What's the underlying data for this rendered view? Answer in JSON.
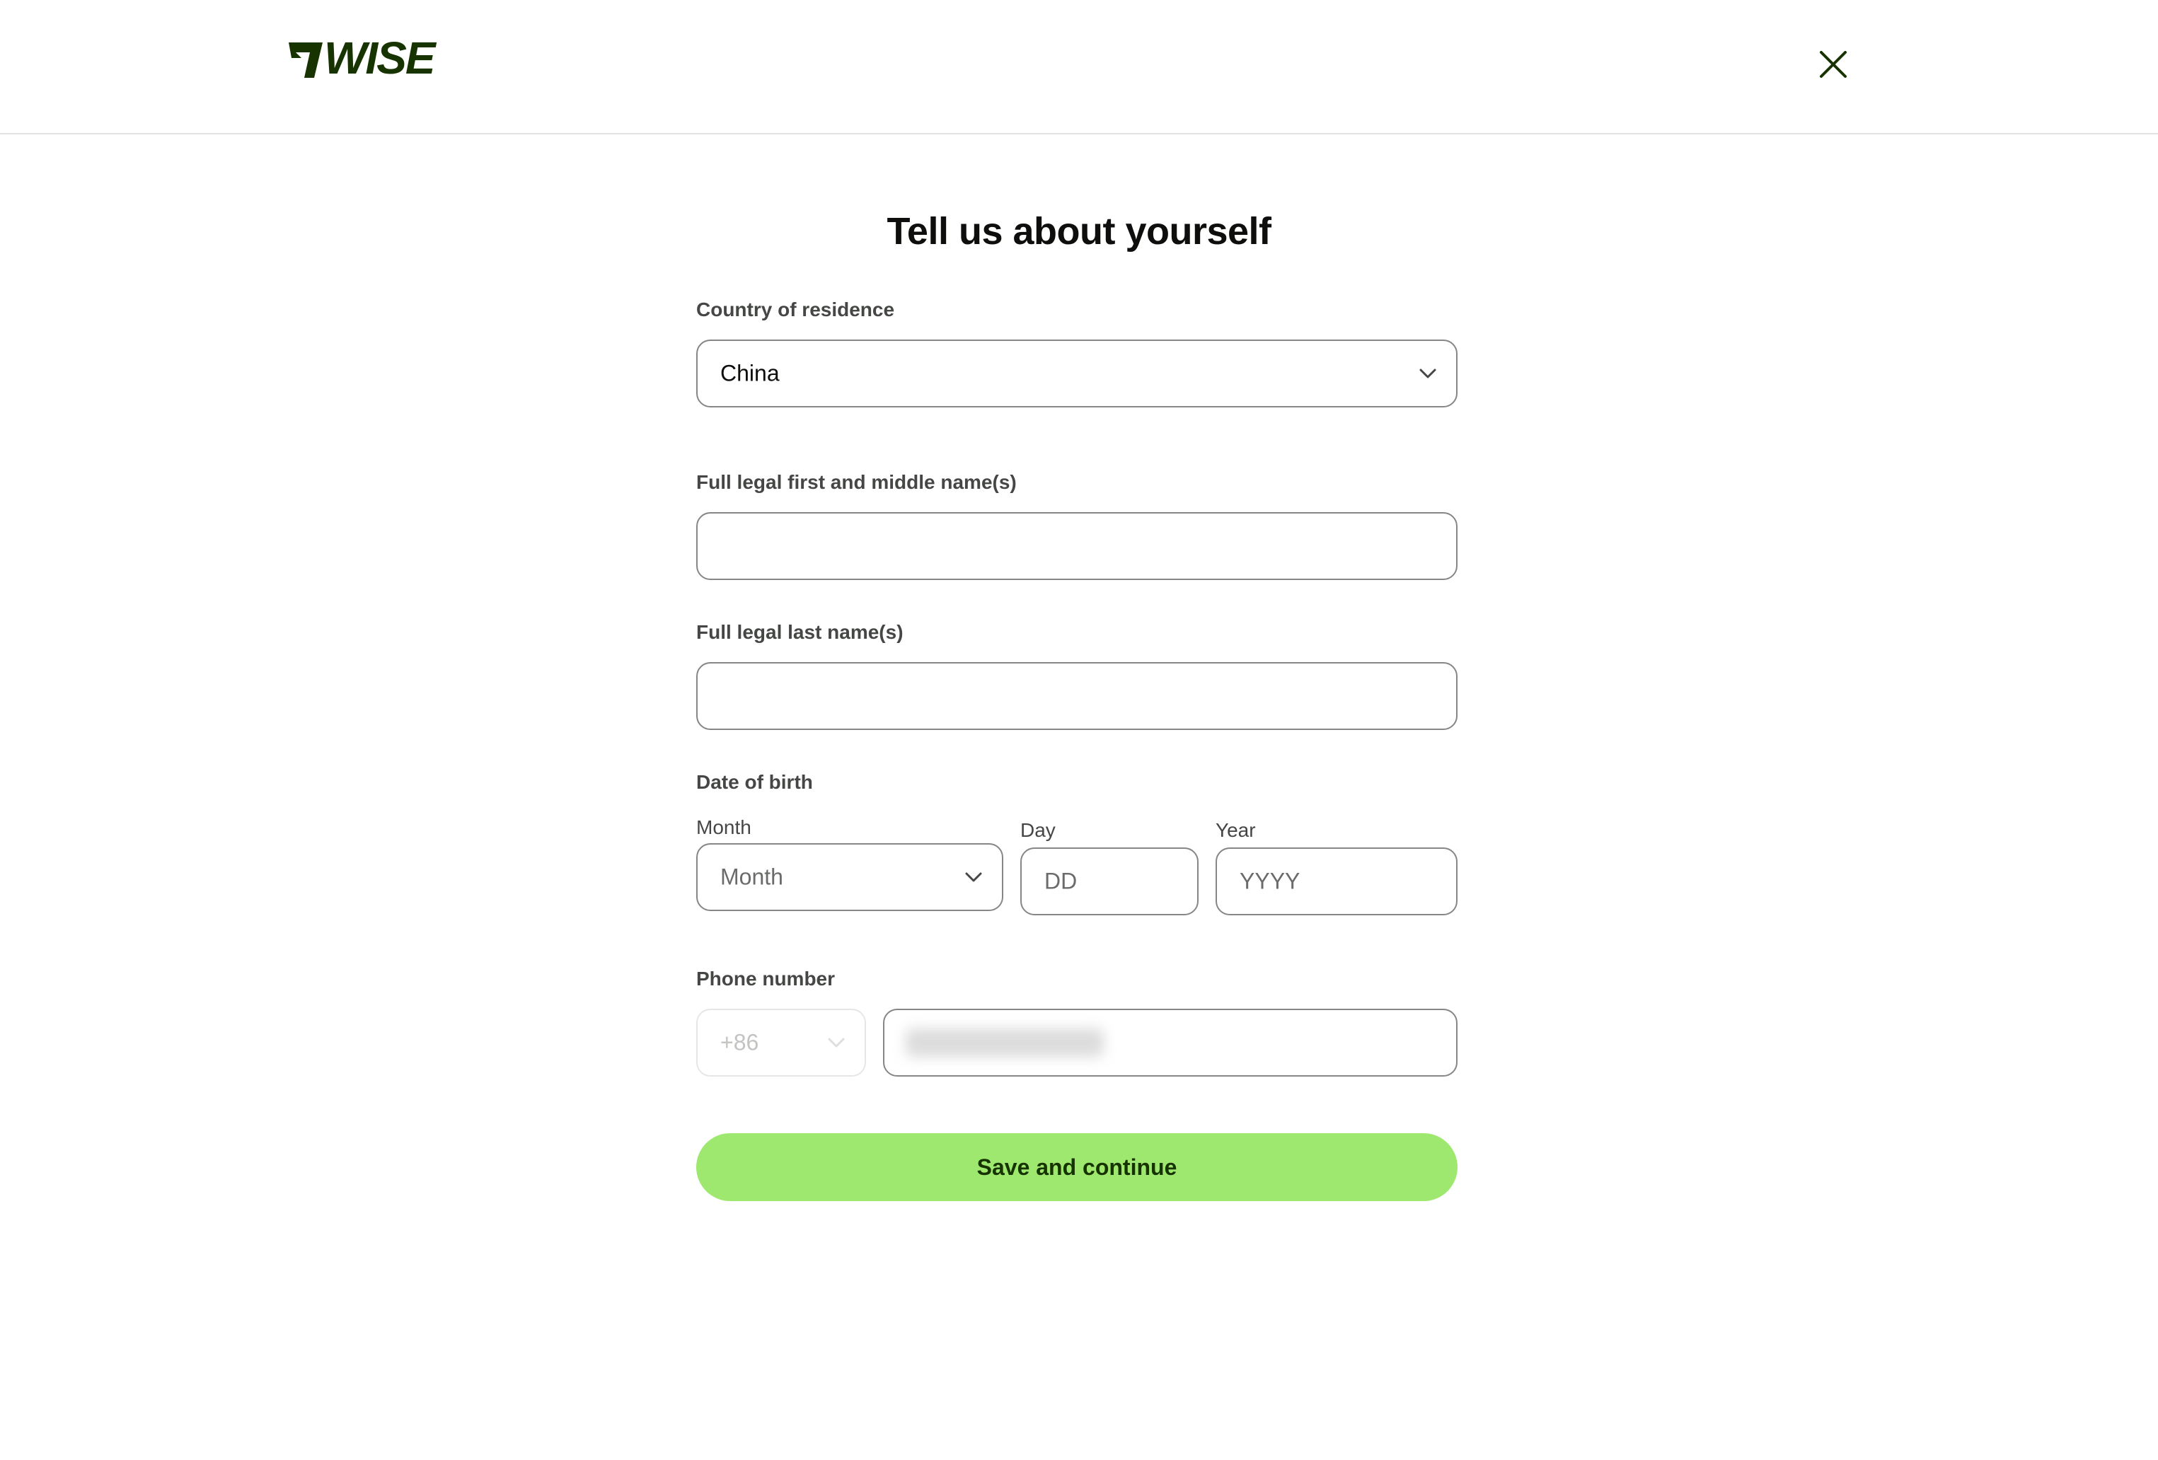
{
  "header": {
    "logo_text": "WISE",
    "close_icon": "close-icon"
  },
  "page": {
    "title": "Tell us about yourself"
  },
  "form": {
    "country": {
      "label": "Country of residence",
      "value": "China",
      "icon": "chevron-down-icon"
    },
    "first_name": {
      "label": "Full legal first and middle name(s)",
      "value": ""
    },
    "last_name": {
      "label": "Full legal last name(s)",
      "value": ""
    },
    "dob": {
      "label": "Date of birth",
      "month_label": "Month",
      "month_placeholder": "Month",
      "day_label": "Day",
      "day_placeholder": "DD",
      "year_label": "Year",
      "year_placeholder": "YYYY"
    },
    "phone": {
      "label": "Phone number",
      "country_code": "+86",
      "number_value_redacted": true
    },
    "submit_label": "Save and continue"
  },
  "colors": {
    "brand_green": "#9fe870",
    "brand_dark_green": "#163300",
    "logo_color": "#163300",
    "border": "#868685",
    "text_label": "#454745"
  }
}
